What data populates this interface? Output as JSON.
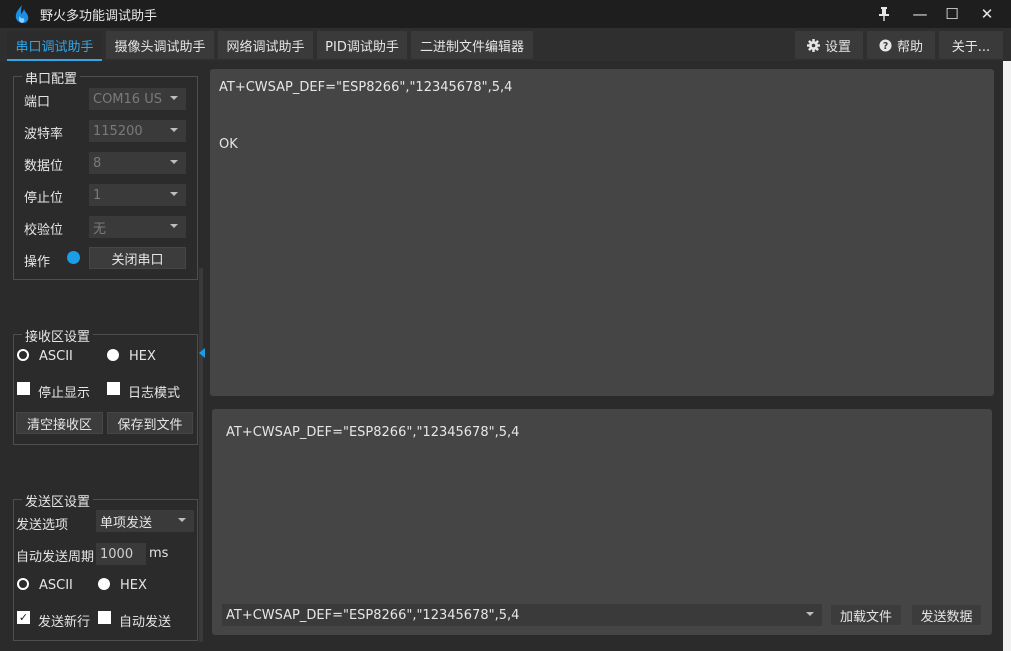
{
  "window": {
    "title": "野火多功能调试助手",
    "pin_icon": "pin-icon",
    "min_glyph": "—",
    "max_glyph": "☐",
    "close_glyph": "✕"
  },
  "tabs": [
    {
      "label": "串口调试助手",
      "active": true
    },
    {
      "label": "摄像头调试助手"
    },
    {
      "label": "网络调试助手"
    },
    {
      "label": "PID调试助手"
    },
    {
      "label": "二进制文件编辑器"
    }
  ],
  "toolbar": {
    "settings_label": "设置",
    "help_label": "帮助",
    "about_label": "关于..."
  },
  "serial_config": {
    "title": "串口配置",
    "port_label": "端口",
    "port_value": "COM16 US",
    "baud_label": "波特率",
    "baud_value": "115200",
    "databits_label": "数据位",
    "databits_value": "8",
    "stopbits_label": "停止位",
    "stopbits_value": "1",
    "parity_label": "校验位",
    "parity_value": "无",
    "op_label": "操作",
    "close_port_label": "关闭串口",
    "status_color": "#1a9ee8"
  },
  "recv_settings": {
    "title": "接收区设置",
    "ascii_label": "ASCII",
    "hex_label": "HEX",
    "stop_display_label": "停止显示",
    "log_mode_label": "日志模式",
    "clear_label": "清空接收区",
    "save_label": "保存到文件"
  },
  "send_settings": {
    "title": "发送区设置",
    "option_label": "发送选项",
    "option_value": "单项发送",
    "period_label": "自动发送周期",
    "period_value": "1000",
    "period_unit": "ms",
    "ascii_label": "ASCII",
    "hex_label": "HEX",
    "newline_label": "发送新行",
    "auto_send_label": "自动发送"
  },
  "receive": {
    "line1": "AT+CWSAP_DEF=\"ESP8266\",\"12345678\",5,4",
    "line2": "OK"
  },
  "send": {
    "text": "AT+CWSAP_DEF=\"ESP8266\",\"12345678\",5,4",
    "history_value": "AT+CWSAP_DEF=\"ESP8266\",\"12345678\",5,4",
    "load_file_label": "加载文件",
    "send_label": "发送数据"
  },
  "colors": {
    "accent": "#33a6e8",
    "background": "#2b2b2b",
    "text_area": "#454545"
  }
}
